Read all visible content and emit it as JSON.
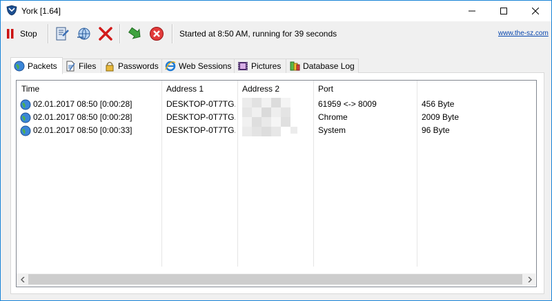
{
  "window": {
    "title": "York [1.64]",
    "icons": {
      "app": "york-shield-icon",
      "minimize": "minimize-icon",
      "maximize": "maximize-icon",
      "close": "close-icon"
    }
  },
  "toolbar": {
    "stop_label": "Stop",
    "buttons": [
      "stop-icon",
      "open-icon",
      "network-icon",
      "delete-icon",
      "export-icon",
      "cancel-icon"
    ],
    "status": "Started at 8:50 AM, running for 39 seconds",
    "link": "www.the-sz.com"
  },
  "tabs": [
    {
      "label": "Packets",
      "icon": "globe-icon",
      "active": true
    },
    {
      "label": "Files",
      "icon": "file-icon",
      "active": false
    },
    {
      "label": "Passwords",
      "icon": "lock-icon",
      "active": false
    },
    {
      "label": "Web Sessions",
      "icon": "browser-icon",
      "active": false
    },
    {
      "label": "Pictures",
      "icon": "film-icon",
      "active": false
    },
    {
      "label": "Database Log",
      "icon": "database-icon",
      "active": false
    }
  ],
  "table": {
    "columns": [
      "Time",
      "Address 1",
      "Address 2",
      "Port",
      ""
    ],
    "rows": [
      {
        "time": "02.01.2017 08:50 [0:00:28]",
        "address1": "DESKTOP-0T7TG...",
        "address2": "",
        "port": "61959 <-> 8009",
        "size": "456 Byte"
      },
      {
        "time": "02.01.2017 08:50 [0:00:28]",
        "address1": "DESKTOP-0T7TG...",
        "address2": "",
        "port": "Chrome",
        "size": "2009 Byte"
      },
      {
        "time": "02.01.2017 08:50 [0:00:33]",
        "address1": "DESKTOP-0T7TG...",
        "address2": "",
        "port": "System",
        "size": "96 Byte"
      }
    ]
  },
  "colors": {
    "accent": "#1883d7",
    "link": "#0645ad",
    "stop_red": "#cc1111"
  }
}
